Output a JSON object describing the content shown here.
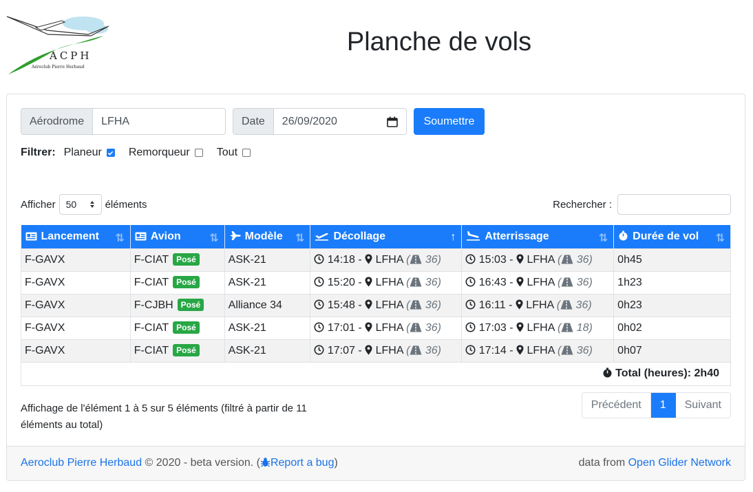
{
  "header": {
    "title": "Planche de vols",
    "logo_text": "ACPH",
    "logo_subtext": "Aéroclub Pierre Herbaud"
  },
  "form": {
    "aerodrome_label": "Aérodrome",
    "aerodrome_value": "LFHA",
    "date_label": "Date",
    "date_value": "26/09/2020",
    "submit_label": "Soumettre"
  },
  "filters": {
    "label": "Filtrer:",
    "options": [
      {
        "label": "Planeur",
        "checked": true
      },
      {
        "label": "Remorqueur",
        "checked": false
      },
      {
        "label": "Tout",
        "checked": false
      }
    ]
  },
  "table_controls": {
    "show_prefix": "Afficher",
    "show_value": "50",
    "show_suffix": "éléments",
    "search_label": "Rechercher :"
  },
  "table": {
    "columns": [
      "Lancement",
      "Avion",
      "Modèle",
      "Décollage",
      "Atterrissage",
      "Durée de vol"
    ],
    "rows": [
      {
        "lancement": "F-GAVX",
        "avion": "F-CIAT",
        "badge": "Posé",
        "modele": "ASK-21",
        "dec_time": "14:18 -",
        "dec_place": "LFHA",
        "dec_rw": "36",
        "att_time": "15:03 -",
        "att_place": "LFHA",
        "att_rw": "36",
        "duree": "0h45"
      },
      {
        "lancement": "F-GAVX",
        "avion": "F-CIAT",
        "badge": "Posé",
        "modele": "ASK-21",
        "dec_time": "15:20 -",
        "dec_place": "LFHA",
        "dec_rw": "36",
        "att_time": "16:43 -",
        "att_place": "LFHA",
        "att_rw": "36",
        "duree": "1h23"
      },
      {
        "lancement": "F-GAVX",
        "avion": "F-CJBH",
        "badge": "Posé",
        "modele": "Alliance 34",
        "dec_time": "15:48 -",
        "dec_place": "LFHA",
        "dec_rw": "36",
        "att_time": "16:11 -",
        "att_place": "LFHA",
        "att_rw": "36",
        "duree": "0h23"
      },
      {
        "lancement": "F-GAVX",
        "avion": "F-CIAT",
        "badge": "Posé",
        "modele": "ASK-21",
        "dec_time": "17:01 -",
        "dec_place": "LFHA",
        "dec_rw": "36",
        "att_time": "17:03 -",
        "att_place": "LFHA",
        "att_rw": "18",
        "duree": "0h02"
      },
      {
        "lancement": "F-GAVX",
        "avion": "F-CIAT",
        "badge": "Posé",
        "modele": "ASK-21",
        "dec_time": "17:07 -",
        "dec_place": "LFHA",
        "dec_rw": "36",
        "att_time": "17:14 -",
        "att_place": "LFHA",
        "att_rw": "36",
        "duree": "0h07"
      }
    ],
    "total_label": "Total (heures): 2h40"
  },
  "pagination": {
    "info": "Affichage de l'élément 1 à 5 sur 5 éléments (filtré à partir de 11 éléments au total)",
    "prev": "Précédent",
    "current": "1",
    "next": "Suivant"
  },
  "footer": {
    "club_link": "Aeroclub Pierre Herbaud",
    "copyright": " © 2020 - beta version. (",
    "bug_link": "Report a bug",
    "close_paren": ")",
    "data_from": "data from ",
    "ogn_link": "Open Glider Network"
  },
  "colors": {
    "primary": "#1a7cfa",
    "success": "#28a745",
    "logo_green": "#2e9e2e"
  }
}
